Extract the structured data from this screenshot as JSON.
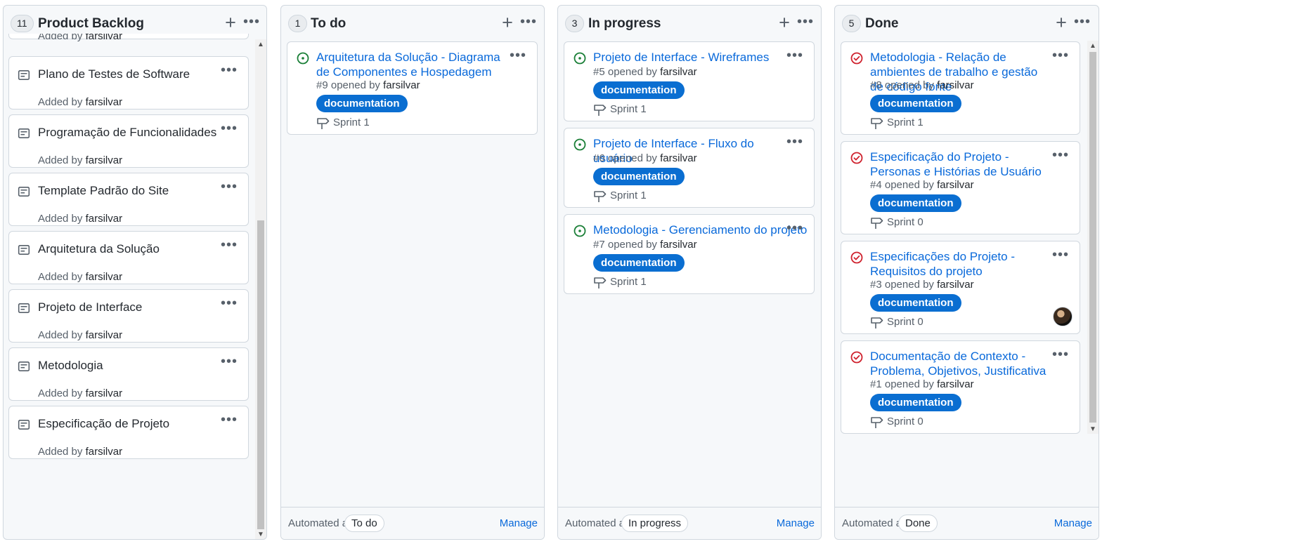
{
  "columns": [
    {
      "count": "11",
      "title": "Product Backlog",
      "partial_item": {
        "added_by_text": "Added by ",
        "user": "farsilvar"
      },
      "notes": [
        {
          "title": "Plano de Testes de Software",
          "added_by_text": "Added by ",
          "user": "farsilvar"
        },
        {
          "title": "Programação de Funcionalidades",
          "added_by_text": "Added by ",
          "user": "farsilvar"
        },
        {
          "title": "Template Padrão do Site",
          "added_by_text": "Added by ",
          "user": "farsilvar"
        },
        {
          "title": "Arquitetura da Solução",
          "added_by_text": "Added by ",
          "user": "farsilvar"
        },
        {
          "title": "Projeto de Interface",
          "added_by_text": "Added by ",
          "user": "farsilvar"
        },
        {
          "title": "Metodologia",
          "added_by_text": "Added by ",
          "user": "farsilvar"
        },
        {
          "title": "Especificação de Projeto",
          "added_by_text": "Added by ",
          "user": "farsilvar"
        }
      ],
      "scroll_fraction": 0.62
    },
    {
      "count": "1",
      "title": "To do",
      "issues": [
        {
          "title": "Arquitetura da Solução - Diagrama de Componentes e Hospedagem",
          "number_text": "#9 opened by ",
          "user": "farsilvar",
          "label": "documentation",
          "milestone": "Sprint 1",
          "state": "open"
        }
      ],
      "automated_as_text": "Automated as",
      "automated_value": "To do",
      "manage_label": "Manage"
    },
    {
      "count": "3",
      "title": "In progress",
      "issues": [
        {
          "title": "Projeto de Interface - Wireframes",
          "number_text": "#5 opened by ",
          "user": "farsilvar",
          "label": "documentation",
          "milestone": "Sprint 1",
          "state": "open"
        },
        {
          "title": "Projeto de Interface - Fluxo do usuário",
          "number_text": "#6 opened by ",
          "user": "farsilvar",
          "label": "documentation",
          "milestone": "Sprint 1",
          "state": "open"
        },
        {
          "title": "Metodologia - Gerenciamento do projeto",
          "number_text": "#7 opened by ",
          "user": "farsilvar",
          "label": "documentation",
          "milestone": "Sprint 1",
          "state": "open"
        }
      ],
      "automated_as_text": "Automated as",
      "automated_value": "In progress",
      "manage_label": "Manage"
    },
    {
      "count": "5",
      "title": "Done",
      "issues": [
        {
          "title": "Metodologia - Relação de ambientes de trabalho e gestão de código fonte",
          "number_text": "#8 opened by ",
          "user": "farsilvar",
          "label": "documentation",
          "milestone": "Sprint 1",
          "state": "closed"
        },
        {
          "title": "Especificação do Projeto - Personas e Histórias de Usuário",
          "number_text": "#4 opened by ",
          "user": "farsilvar",
          "label": "documentation",
          "milestone": "Sprint 0",
          "state": "closed"
        },
        {
          "title": "Especificações do Projeto - Requisitos do projeto",
          "number_text": "#3 opened by ",
          "user": "farsilvar",
          "label": "documentation",
          "milestone": "Sprint 0",
          "state": "closed",
          "has_avatar": true
        },
        {
          "title": "Documentação de Contexto - Problema, Objetivos, Justificativa",
          "number_text": "#1 opened by ",
          "user": "farsilvar",
          "label": "documentation",
          "milestone": "Sprint 0",
          "state": "closed"
        }
      ],
      "automated_as_text": "Automated as",
      "automated_value": "Done",
      "manage_label": "Manage"
    }
  ],
  "colors": {
    "open_icon": "#1a7f37",
    "closed_icon": "#cf222e",
    "label_bg": "#0a6ed1",
    "link": "#0969da"
  },
  "icons": {
    "add": "plus-icon",
    "more": "kebab-icon",
    "note": "note-icon",
    "issue_open": "issue-opened-icon",
    "issue_closed": "issue-closed-icon",
    "milestone": "milestone-icon"
  }
}
